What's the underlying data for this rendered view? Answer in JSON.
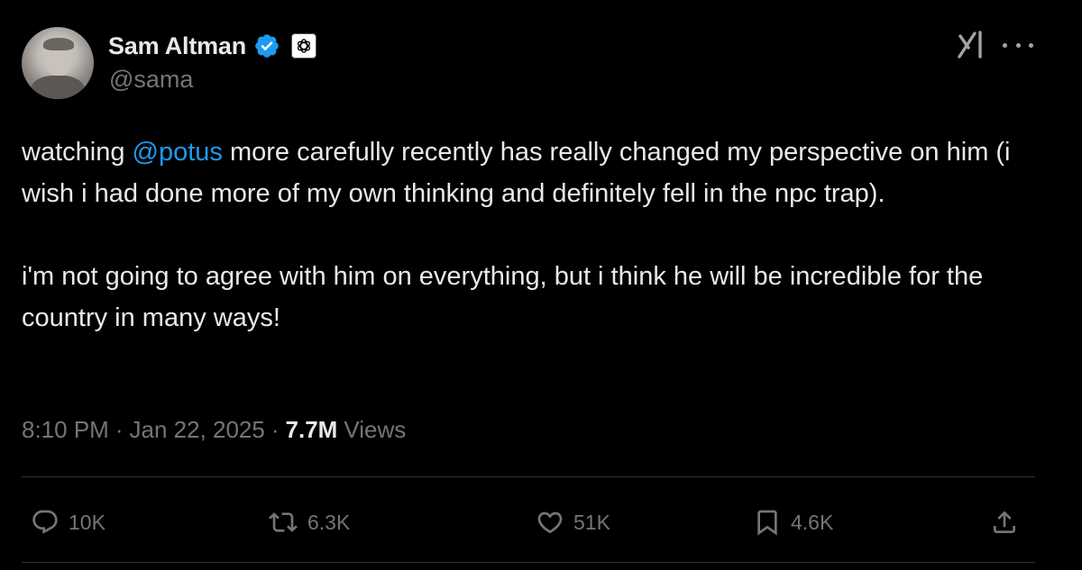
{
  "author": {
    "display_name": "Sam Altman",
    "handle": "@sama",
    "verified": true,
    "affiliation_icon": "openai-logo-icon"
  },
  "tweet": {
    "para1_before": "watching ",
    "mention": "@potus",
    "para1_after": " more carefully recently has really changed my perspective on him (i wish i had done more of my own thinking and definitely fell in the npc trap).",
    "para2": "i'm not going to agree with him on everything, but i think he will be incredible for the country in many ways!"
  },
  "meta": {
    "time": "8:10 PM",
    "dot1": "·",
    "date": "Jan 22, 2025",
    "dot2": "·",
    "views_count": "7.7M",
    "views_label": "Views"
  },
  "actions": {
    "replies": "10K",
    "reposts": "6.3K",
    "likes": "51K",
    "bookmarks": "4.6K"
  },
  "icons": {
    "header_right": [
      "grok-icon",
      "more-icon"
    ],
    "actions": [
      "reply-icon",
      "repost-icon",
      "like-icon",
      "bookmark-icon",
      "share-icon"
    ]
  },
  "colors": {
    "background": "#000000",
    "text": "#e7e9ea",
    "secondary": "#71767b",
    "accent": "#1d9bf0",
    "divider": "#2f3336"
  }
}
